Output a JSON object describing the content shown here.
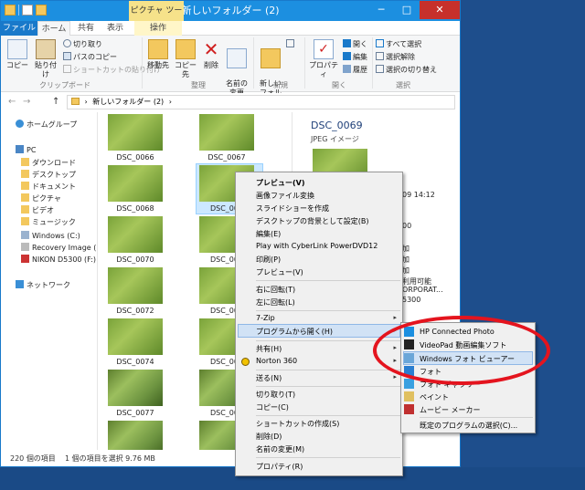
{
  "titlebar": {
    "title": "新しいフォルダー (2)",
    "context_tab": "ピクチャ ツール",
    "minimize": "─",
    "maximize": "□",
    "close": "✕"
  },
  "tabs": {
    "file": "ファイル",
    "home": "ホーム",
    "share": "共有",
    "view": "表示",
    "manage": "操作"
  },
  "ribbon": {
    "copy": "コピー",
    "paste": "貼り付け",
    "cut": "切り取り",
    "copy_path": "パスのコピー",
    "paste_shortcut": "ショートカットの貼り付け",
    "clipboard_group": "クリップボード",
    "move_to": "移動先",
    "copy_to": "コピー先",
    "delete": "削除",
    "rename": "名前の\n変更",
    "organize_group": "整理",
    "new_folder": "新しい\nフォルダー",
    "new_group": "新規",
    "properties": "プロパティ",
    "open_btn": "開く",
    "edit_btn": "編集",
    "history_btn": "履歴",
    "open_group": "開く",
    "select_all": "すべて選択",
    "select_none": "選択解除",
    "invert_selection": "選択の切り替え",
    "select_group": "選択"
  },
  "address": {
    "path": "新しいフォルダー (2)",
    "back": "←",
    "forward": "→",
    "up": "↑"
  },
  "navpane": {
    "homegroup": "ホームグループ",
    "pc": "PC",
    "items": [
      "ダウンロード",
      "デスクトップ",
      "ドキュメント",
      "ピクチャ",
      "ビデオ",
      "ミュージック",
      "Windows (C:)",
      "Recovery Image (",
      "NIKON D5300 (F:)"
    ],
    "network": "ネットワーク"
  },
  "files": [
    "DSC_0066",
    "DSC_0067",
    "DSC_0068",
    "DSC_006",
    "DSC_0070",
    "DSC_007",
    "DSC_0072",
    "DSC_007",
    "DSC_0074",
    "DSC_007",
    "DSC_0077",
    "DSC_007"
  ],
  "preview": {
    "title": "DSC_0069",
    "type": "JPEG イメージ",
    "partial": [
      "09 14:12",
      "00",
      "加",
      "加",
      "加",
      "利用可能",
      "ORPORAT...",
      "5300"
    ]
  },
  "status": {
    "count": "220 個の項目",
    "selected": "1 個の項目を選択  9.76 MB"
  },
  "context_menu": {
    "preview_bold": "プレビュー(V)",
    "convert": "画像ファイル変換",
    "slideshow": "スライドショーを作成",
    "wallpaper": "デスクトップの背景として設定(B)",
    "edit": "編集(E)",
    "powerdvd": "Play with CyberLink PowerDVD12",
    "print": "印刷(P)",
    "preview2": "プレビュー(V)",
    "rotate_right": "右に回転(T)",
    "rotate_left": "左に回転(L)",
    "zip": "7-Zip",
    "open_with": "プログラムから開く(H)",
    "share": "共有(H)",
    "norton": "Norton 360",
    "send_to": "送る(N)",
    "cut": "切り取り(T)",
    "copy": "コピー(C)",
    "create_shortcut": "ショートカットの作成(S)",
    "delete": "削除(D)",
    "rename": "名前の変更(M)",
    "properties": "プロパティ(R)",
    "arrow": "▸"
  },
  "submenu": {
    "items": [
      "HP Connected Photo",
      "VideoPad 動画編集ソフト",
      "Windows フォト ビューアー",
      "フォト",
      "フォト ギャラリー",
      "ペイント",
      "ムービー メーカー"
    ],
    "choose": "既定のプログラムの選択(C)..."
  },
  "colors": {
    "accent": "#1979ca",
    "highlight": "#e4141e",
    "menu_hover": "#d1e2f5"
  }
}
